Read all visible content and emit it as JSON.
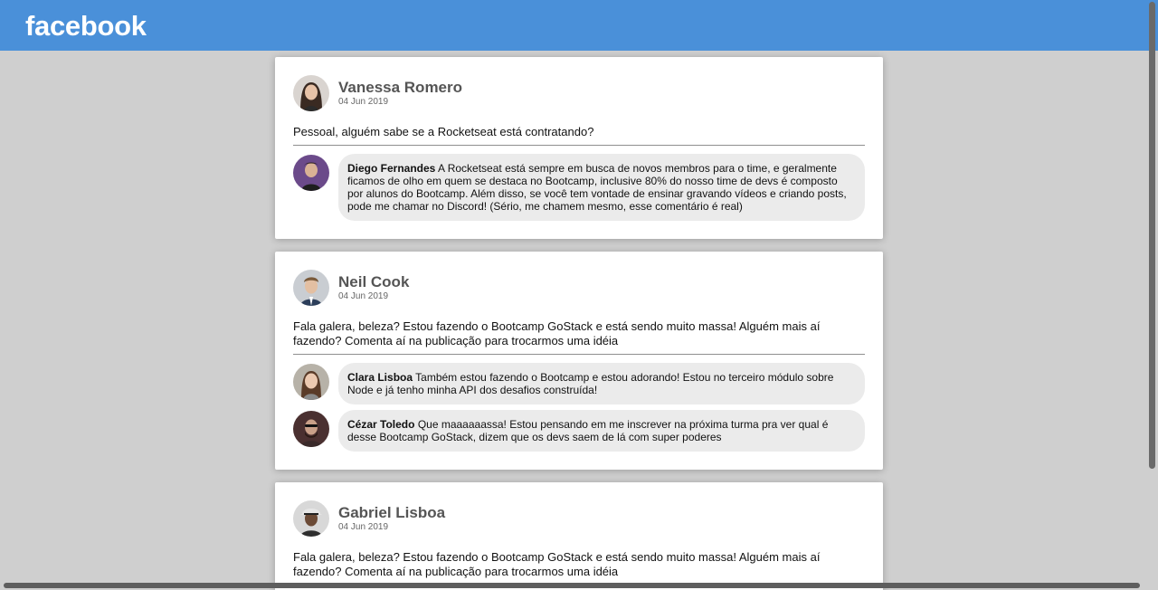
{
  "header": {
    "logo": "facebook",
    "bg_color": "#4a90d9"
  },
  "posts": [
    {
      "author": "Vanessa Romero",
      "date": "04 Jun 2019",
      "avatar": "woman-portrait",
      "text": "Pessoal, alguém sabe se a Rocketseat está contratando?",
      "comments": [
        {
          "author": "Diego Fernandes",
          "avatar": "man-portrait",
          "text": "A Rocketseat está sempre em busca de novos membros para o time, e geralmente ficamos de olho em quem se destaca no Bootcamp, inclusive 80% do nosso time de devs é composto por alunos do Bootcamp. Além disso, se você tem vontade de ensinar gravando vídeos e criando posts, pode me chamar no Discord! (Sério, me chamem mesmo, esse comentário é real)"
        }
      ]
    },
    {
      "author": "Neil Cook",
      "date": "04 Jun 2019",
      "avatar": "man-portrait",
      "text": "Fala galera, beleza? Estou fazendo o Bootcamp GoStack e está sendo muito massa! Alguém mais aí fazendo? Comenta aí na publicação para trocarmos uma idéia",
      "comments": [
        {
          "author": "Clara Lisboa",
          "avatar": "woman-portrait",
          "text": "Também estou fazendo o Bootcamp e estou adorando! Estou no terceiro módulo sobre Node e já tenho minha API dos desafios construída!"
        },
        {
          "author": "Cézar Toledo",
          "avatar": "man-portrait",
          "text": "Que maaaaaassa! Estou pensando em me inscrever na próxima turma pra ver qual é desse Bootcamp GoStack, dizem que os devs saem de lá com super poderes"
        }
      ]
    },
    {
      "author": "Gabriel Lisboa",
      "date": "04 Jun 2019",
      "avatar": "man-portrait",
      "text": "Fala galera, beleza? Estou fazendo o Bootcamp GoStack e está sendo muito massa! Alguém mais aí fazendo? Comenta aí na publicação para trocarmos uma idéia"
    }
  ]
}
